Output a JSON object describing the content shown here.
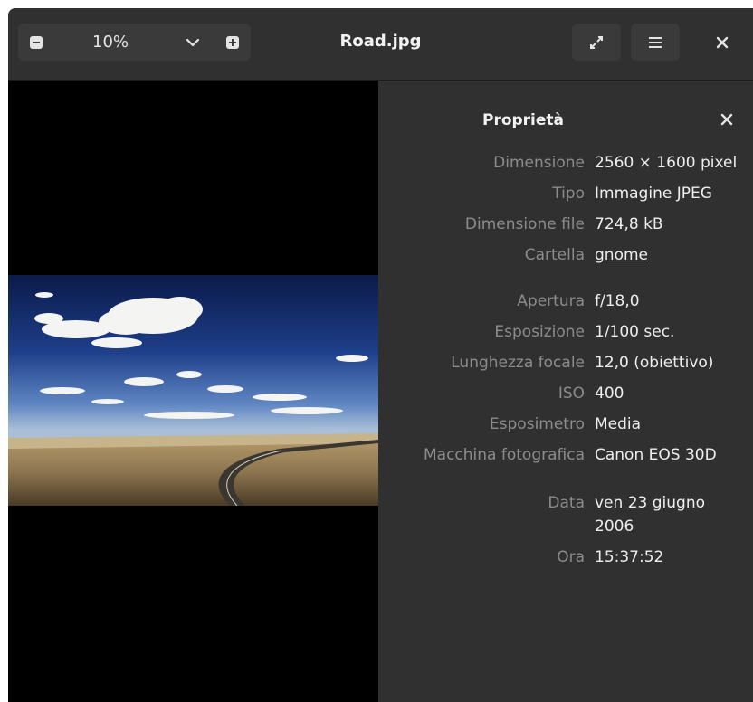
{
  "header": {
    "zoom_level": "10%",
    "title": "Road.jpg",
    "icons": {
      "zoom_out": "zoom-out-icon",
      "zoom_in": "zoom-in-icon",
      "dropdown": "chevron-down-icon",
      "fullscreen": "fullscreen-icon",
      "menu": "hamburger-menu-icon",
      "close": "close-icon"
    }
  },
  "properties": {
    "title": "Proprietà",
    "rows": [
      {
        "label": "Dimensione",
        "value": "2560 × 1600 pixel"
      },
      {
        "label": "Tipo",
        "value": "Immagine JPEG"
      },
      {
        "label": "Dimensione file",
        "value": "724,8 kB"
      },
      {
        "label": "Cartella",
        "value": "gnome"
      },
      {
        "label": "Apertura",
        "value": "f/18,0"
      },
      {
        "label": "Esposizione",
        "value": "1/100 sec."
      },
      {
        "label": "Lunghezza focale",
        "value": "12,0 (obiettivo)"
      },
      {
        "label": "ISO",
        "value": "400"
      },
      {
        "label": "Esposimetro",
        "value": "Media"
      },
      {
        "label": "Macchina fotografica",
        "value": "Canon EOS 30D"
      },
      {
        "label": "Data",
        "value": "ven 23 giugno",
        "value_line2": "2006"
      },
      {
        "label": "Ora",
        "value": "15:37:52"
      }
    ]
  },
  "colors": {
    "window_bg": "#242424",
    "headerbar_bg": "#303030",
    "link": "#78aeed",
    "label": "#8c8c8c"
  }
}
